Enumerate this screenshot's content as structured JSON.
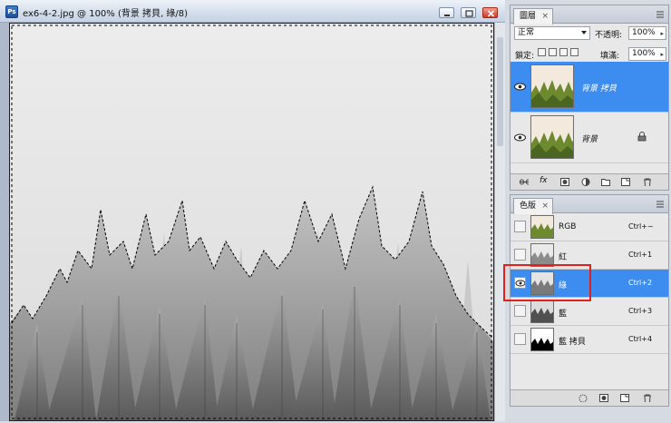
{
  "document": {
    "title": "ex6-4-2.jpg @ 100% (背景 拷貝, 綠/8)",
    "app_icon": "Ps"
  },
  "layers_panel": {
    "tab_label": "圖層",
    "close_glyph": "×",
    "blend_mode": "正常",
    "opacity_label": "不透明:",
    "opacity_value": "100%",
    "lock_label": "鎖定:",
    "fill_label": "填滿:",
    "fill_value": "100%",
    "layers": [
      {
        "name": "背景 拷貝",
        "selected": true,
        "visible": true
      },
      {
        "name": "背景",
        "selected": false,
        "visible": true,
        "locked": true
      }
    ],
    "footer_icons": [
      "link-icon",
      "fx-icon",
      "mask-icon",
      "adjustment-icon",
      "group-icon",
      "new-layer-icon",
      "trash-icon"
    ]
  },
  "channels_panel": {
    "tab_label": "色版",
    "close_glyph": "×",
    "channels": [
      {
        "name": "RGB",
        "shortcut": "Ctrl+~",
        "selected": false,
        "visible": false
      },
      {
        "name": "紅",
        "shortcut": "Ctrl+1",
        "selected": false,
        "visible": false
      },
      {
        "name": "綠",
        "shortcut": "Ctrl+2",
        "selected": true,
        "visible": true
      },
      {
        "name": "藍",
        "shortcut": "Ctrl+3",
        "selected": false,
        "visible": false
      },
      {
        "name": "藍 拷貝",
        "shortcut": "Ctrl+4",
        "selected": false,
        "visible": false
      }
    ],
    "footer_icons": [
      "selection-circle-icon",
      "save-selection-icon",
      "new-channel-icon",
      "trash-icon"
    ]
  },
  "colors": {
    "selection_blue": "#3d8cf0",
    "highlight_red": "#e3201b"
  }
}
